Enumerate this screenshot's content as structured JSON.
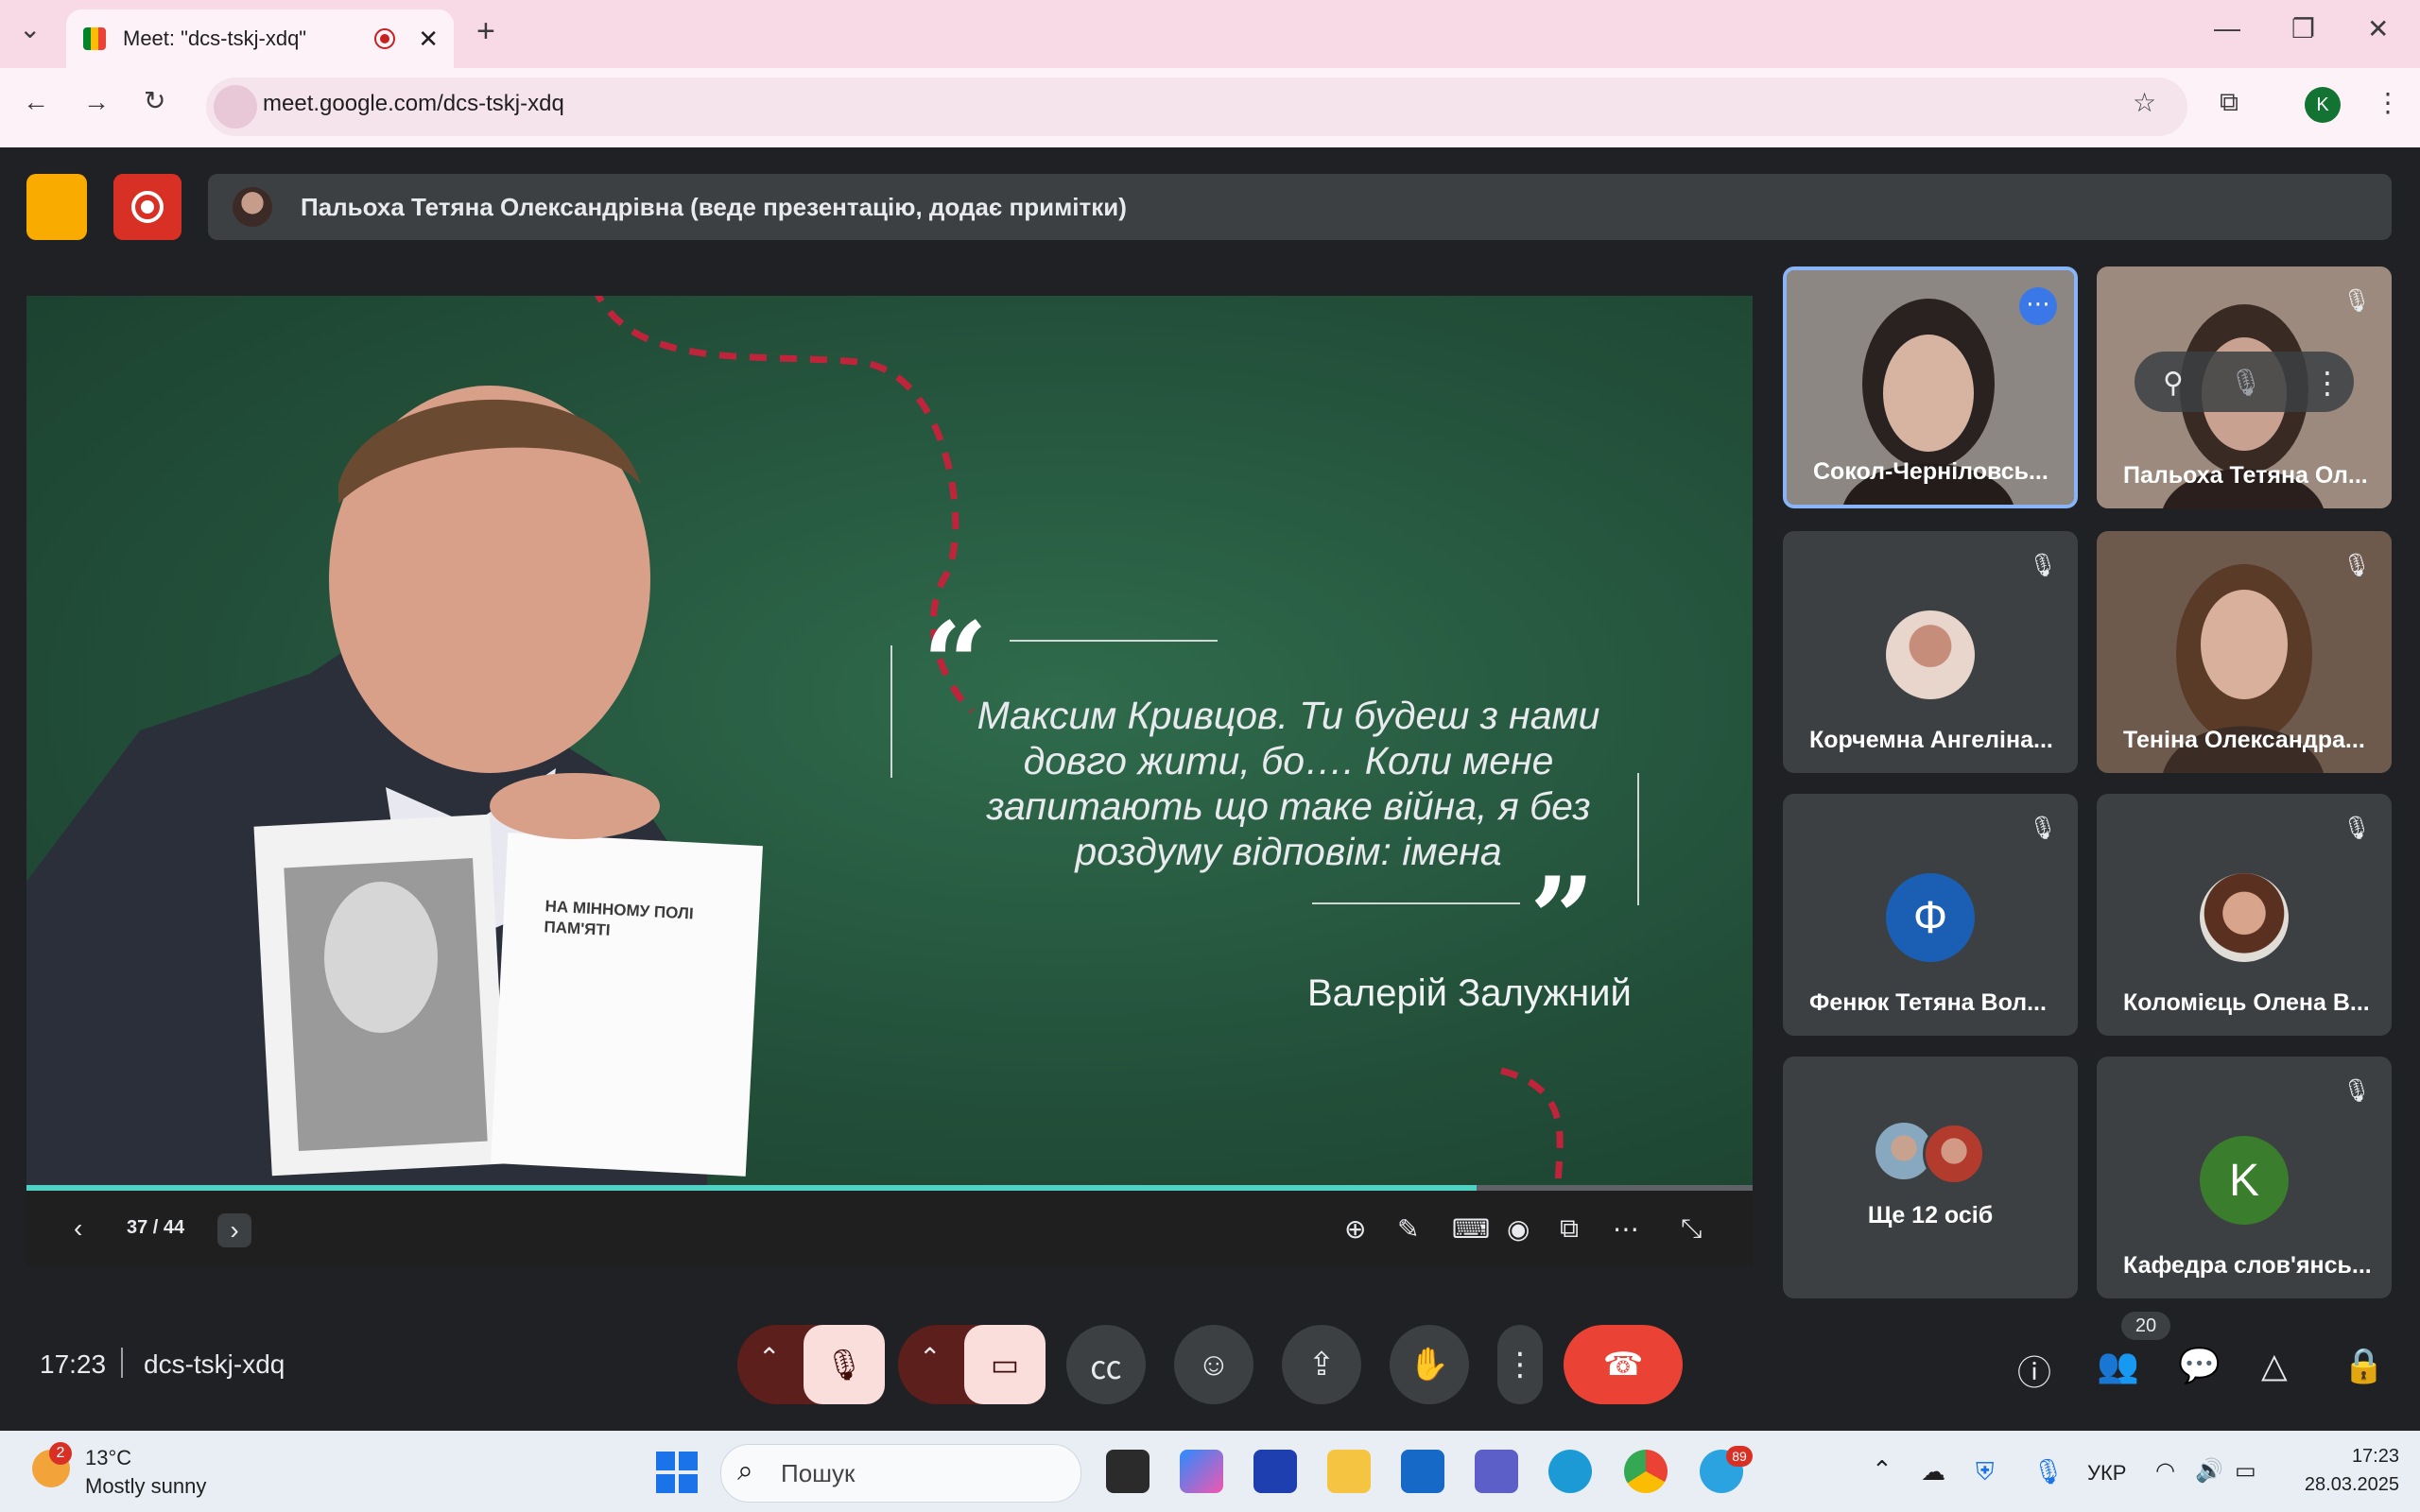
{
  "browser": {
    "tab_title": "Meet: \"dcs-tskj-xdq\"",
    "url": "meet.google.com/dcs-tskj-xdq",
    "profile_initial": "K"
  },
  "meet": {
    "presenter_banner": "Пальоха Тетяна Олександрівна (веде презентацію, додає примітки)",
    "slide": {
      "quote": "Максим Кривцов. Ти будеш з нами довго жити, бо…. Коли мене запитають що таке війна, я без роздуму відповім: імена",
      "author": "Валерій Залужний",
      "book_title": "НА МІННОМУ ПОЛІ ПАМ'ЯТІ",
      "page_indicator": "37 / 44",
      "progress": 0.84
    },
    "participants": [
      {
        "name": "Сокол-Черніловсь...",
        "avatar_type": "video",
        "muted": false
      },
      {
        "name": "Пальоха Тетяна Ол...",
        "avatar_type": "video",
        "muted": true
      },
      {
        "name": "Корчемна Ангеліна...",
        "avatar_type": "photo",
        "muted": true
      },
      {
        "name": "Теніна Олександра...",
        "avatar_type": "video",
        "muted": true
      },
      {
        "name": "Фенюк Тетяна Вол...",
        "avatar_type": "letter",
        "letter": "Ф",
        "color": "#1a5fb4",
        "muted": true
      },
      {
        "name": "Коломієць Олена В...",
        "avatar_type": "photo",
        "muted": true
      },
      {
        "name": "Ще 12 осіб",
        "avatar_type": "group",
        "muted": false
      },
      {
        "name": "Кафедра слов'янсь...",
        "avatar_type": "letter",
        "letter": "K",
        "color": "#3a7d2c",
        "muted": true
      }
    ],
    "time": "17:23",
    "meeting_code": "dcs-tskj-xdq",
    "participant_count": "20"
  },
  "taskbar": {
    "weather_badge": "2",
    "weather_temp": "13°C",
    "weather_desc": "Mostly sunny",
    "search_placeholder": "Пошук",
    "telegram_badge": "89",
    "language": "УКР",
    "clock": "17:23",
    "date": "28.03.2025"
  },
  "colors": {
    "meet_bg": "#202124",
    "tile_bg": "#3c4043",
    "leave_red": "#ea4335",
    "accent_blue": "#8ab4f8"
  }
}
